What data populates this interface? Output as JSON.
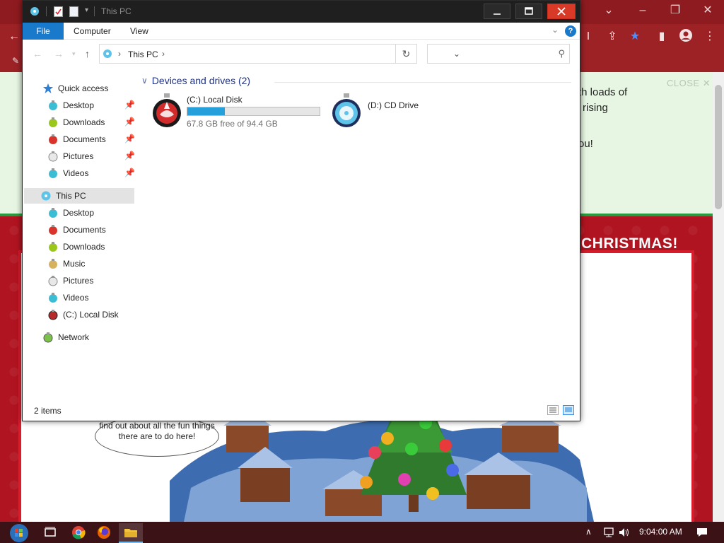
{
  "background_browser": {
    "promo_lines": [
      "th loads of",
      "rising",
      "ou!"
    ],
    "close_label": "CLOSE",
    "banner_text": "CHRISTMAS!",
    "bubble_text": "find out about all the fun things there are to do here!"
  },
  "explorer": {
    "window_title": "This PC",
    "ribbon_tabs": [
      "File",
      "Computer",
      "View"
    ],
    "help_label": "?",
    "address_crumb": "This PC",
    "search_placeholder": "",
    "nav": {
      "quick_access_label": "Quick access",
      "quick_access_items": [
        "Desktop",
        "Downloads",
        "Documents",
        "Pictures",
        "Videos"
      ],
      "this_pc_label": "This PC",
      "this_pc_items": [
        "Desktop",
        "Documents",
        "Downloads",
        "Music",
        "Pictures",
        "Videos",
        "(C:) Local Disk"
      ],
      "network_label": "Network"
    },
    "group_heading": "Devices and drives (2)",
    "drives": [
      {
        "name": "(C:) Local Disk",
        "free_text": "67.8 GB free of 94.4 GB",
        "used_fraction": 0.282
      },
      {
        "name": "(D:) CD Drive"
      }
    ],
    "status_text": "2 items"
  },
  "taskbar": {
    "clock": "9:04:00 AM"
  },
  "colors": {
    "accent": "#1979ca",
    "drive_bar": "#26a0da",
    "close_button": "#d93a27",
    "browser_theme": "#9c2226"
  }
}
